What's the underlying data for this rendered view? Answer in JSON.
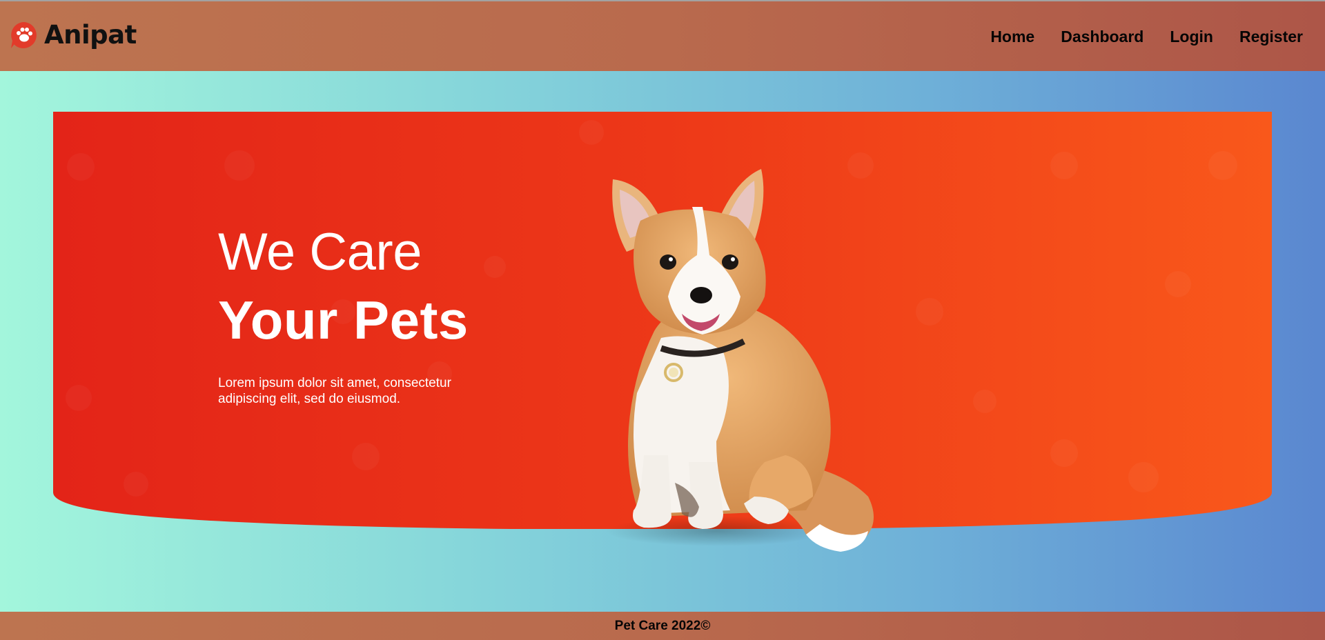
{
  "brand": {
    "name": "Anipat",
    "logo_icon": "paw-chat-bubble-icon"
  },
  "nav": {
    "items": [
      "Home",
      "Dashboard",
      "Login",
      "Register"
    ]
  },
  "hero": {
    "line1": "We Care",
    "line2": "Your Pets",
    "description": "Lorem ipsum dolor sit amet, consectetur adipiscing elit, sed do eiusmod."
  },
  "footer": {
    "text": "Pet Care 2022©"
  },
  "colors": {
    "header_bar": "#b96a4d",
    "hero_red": "#e5261a",
    "hero_orange": "#f85a1b",
    "page_gradient_start": "#a3f6dc",
    "page_gradient_end": "#5a87d0"
  }
}
